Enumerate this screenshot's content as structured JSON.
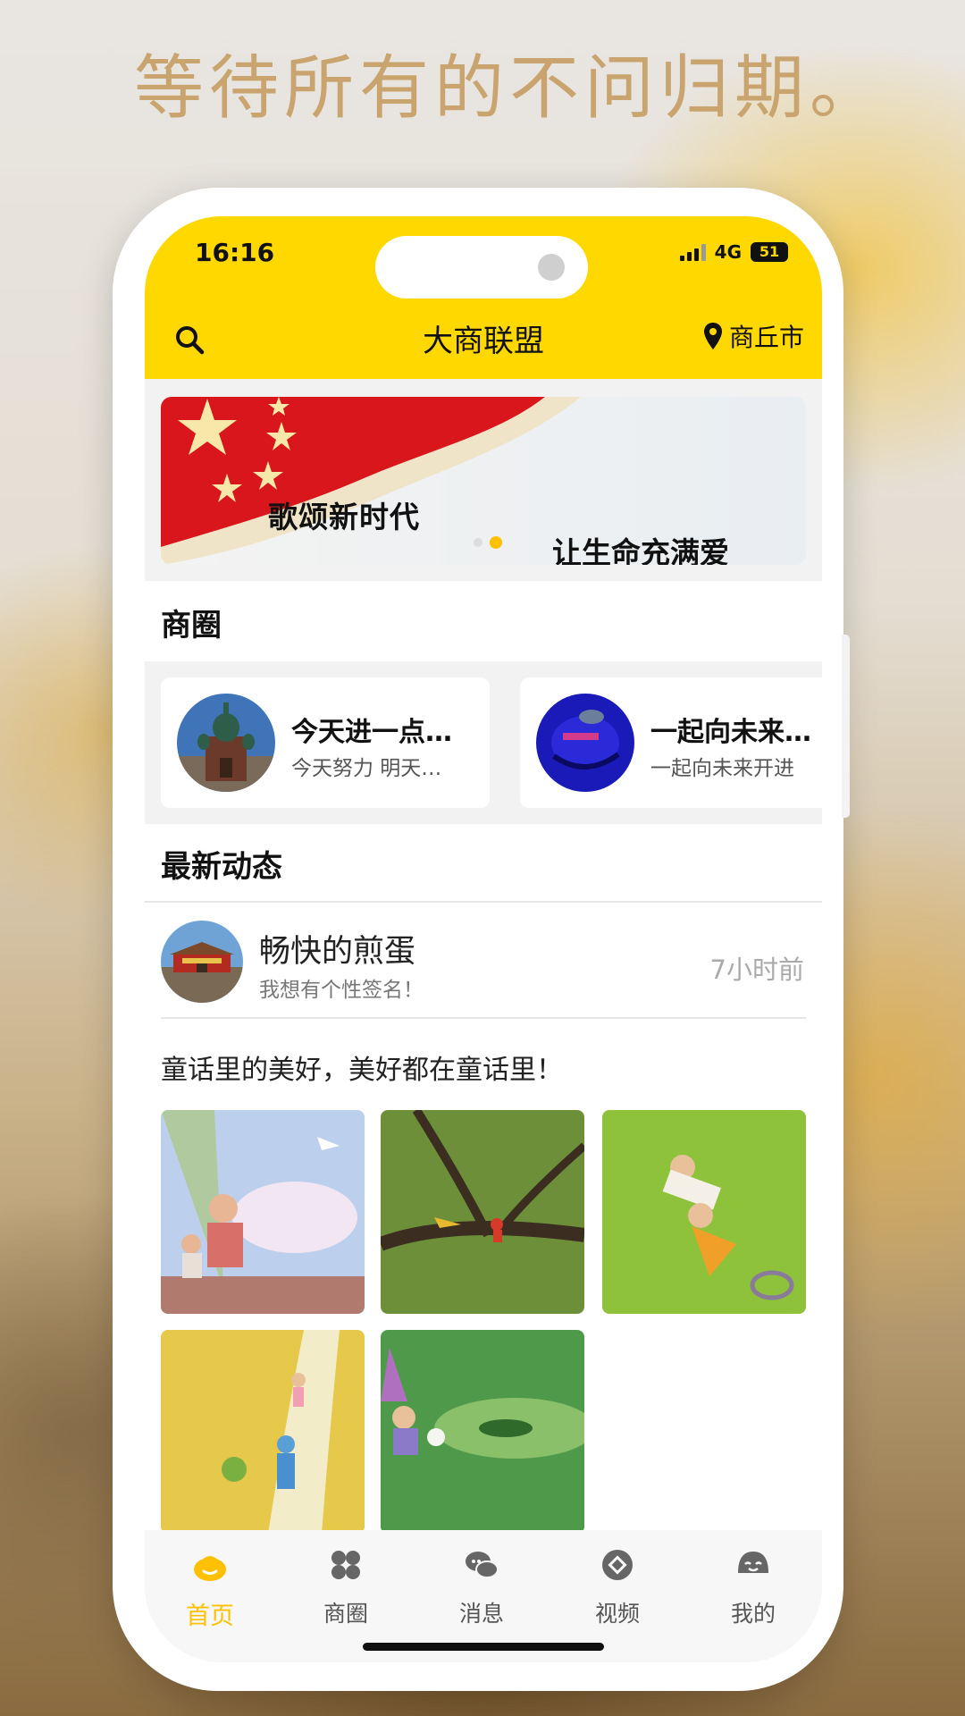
{
  "promo": {
    "headline": "等待所有的不问归期。"
  },
  "status_bar": {
    "time": "16:16",
    "network": "4G",
    "battery": "51"
  },
  "header": {
    "title": "大商联盟",
    "location": "商丘市"
  },
  "banner": {
    "text_left": "歌颂新时代",
    "text_right": "让生命充满爱",
    "slide_count": 2,
    "active_slide": 2
  },
  "business_circles": {
    "title": "商圈",
    "items": [
      {
        "name": "今天进一点…",
        "desc": "今天努力 明天…"
      },
      {
        "name": "一起向未来…",
        "desc": "一起向未来开进"
      }
    ]
  },
  "feed": {
    "title": "最新动态",
    "post": {
      "author": "畅快的煎蛋",
      "signature": "我想有个性签名！",
      "time": "7小时前",
      "text": "童话里的美好，美好都在童话里！",
      "image_count": 5
    }
  },
  "tabs": [
    {
      "label": "首页",
      "icon": "home-icon",
      "active": true
    },
    {
      "label": "商圈",
      "icon": "grid-icon",
      "active": false
    },
    {
      "label": "消息",
      "icon": "chat-icon",
      "active": false
    },
    {
      "label": "视频",
      "icon": "video-icon",
      "active": false
    },
    {
      "label": "我的",
      "icon": "profile-icon",
      "active": false
    }
  ],
  "colors": {
    "accent": "#ffd800",
    "tab_active": "#ffc000"
  }
}
